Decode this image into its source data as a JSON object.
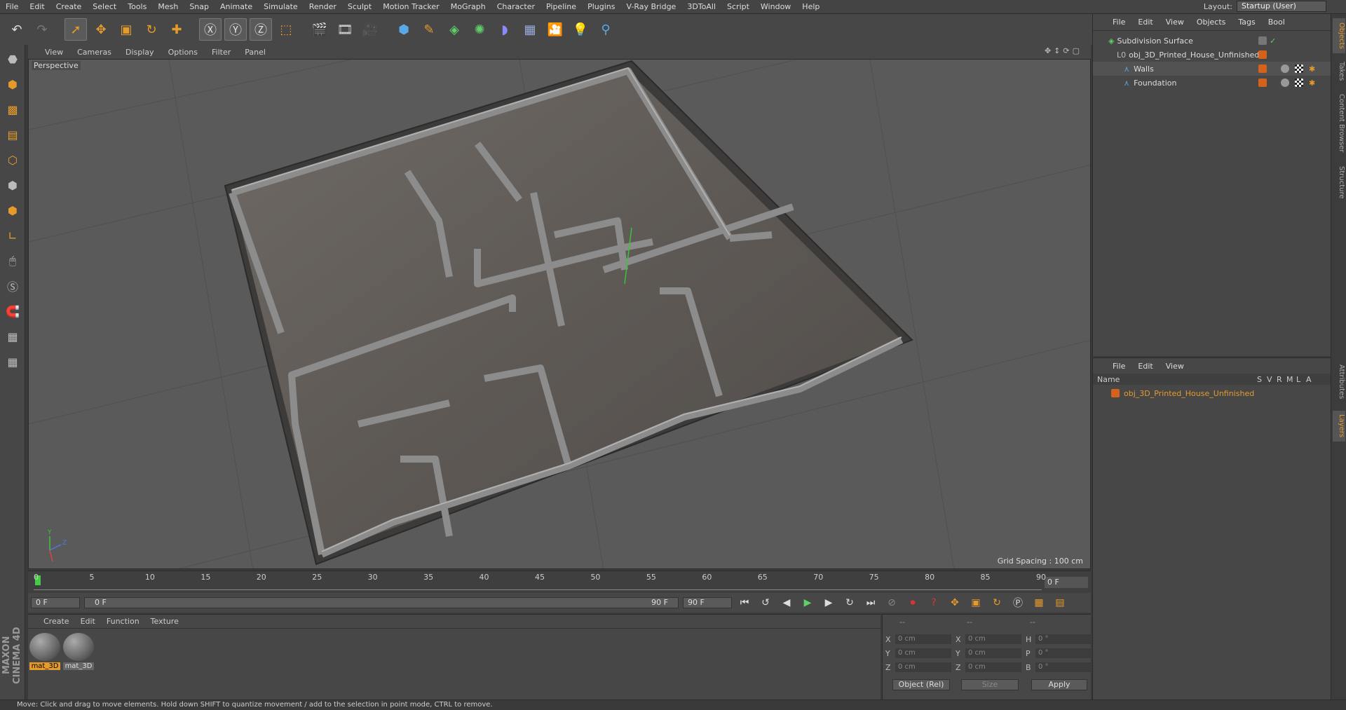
{
  "menu": [
    "File",
    "Edit",
    "Create",
    "Select",
    "Tools",
    "Mesh",
    "Snap",
    "Animate",
    "Simulate",
    "Render",
    "Sculpt",
    "Motion Tracker",
    "MoGraph",
    "Character",
    "Pipeline",
    "Plugins",
    "V-Ray Bridge",
    "3DToAll",
    "Script",
    "Window",
    "Help"
  ],
  "layout": {
    "label": "Layout:",
    "value": "Startup (User)"
  },
  "viewport": {
    "menu": [
      "View",
      "Cameras",
      "Display",
      "Options",
      "Filter",
      "Panel"
    ],
    "label": "Perspective",
    "grid_spacing": "Grid Spacing : 100 cm"
  },
  "timeline": {
    "ticks": [
      "0",
      "5",
      "10",
      "15",
      "20",
      "25",
      "30",
      "35",
      "40",
      "45",
      "50",
      "55",
      "60",
      "65",
      "70",
      "75",
      "80",
      "85",
      "90"
    ],
    "current_frame": "0 F"
  },
  "playback": {
    "start": "0 F",
    "range_start": "0 F",
    "range_end": "90 F",
    "end": "90 F"
  },
  "materials": {
    "menu": [
      "Create",
      "Edit",
      "Function",
      "Texture"
    ],
    "items": [
      "mat_3D",
      "mat_3D"
    ]
  },
  "coords": {
    "headers": [
      "--",
      "--",
      "--"
    ],
    "rows": [
      {
        "l1": "X",
        "v1": "0 cm",
        "l2": "X",
        "v2": "0 cm",
        "l3": "H",
        "v3": "0 °"
      },
      {
        "l1": "Y",
        "v1": "0 cm",
        "l2": "Y",
        "v2": "0 cm",
        "l3": "P",
        "v3": "0 °"
      },
      {
        "l1": "Z",
        "v1": "0 cm",
        "l2": "Z",
        "v2": "0 cm",
        "l3": "B",
        "v3": "0 °"
      }
    ],
    "mode": "Object (Rel)",
    "size": "Size",
    "apply": "Apply"
  },
  "objects": {
    "menu": [
      "File",
      "Edit",
      "View",
      "Objects",
      "Tags",
      "Bool"
    ],
    "items": [
      {
        "name": "Subdivision Surface",
        "level": 0
      },
      {
        "name": "obj_3D_Printed_House_Unfinished",
        "level": 1
      },
      {
        "name": "Walls",
        "level": 2
      },
      {
        "name": "Foundation",
        "level": 2
      }
    ]
  },
  "layers": {
    "menu": [
      "File",
      "Edit",
      "View"
    ],
    "headers": [
      "Name",
      "S",
      "V",
      "R",
      "M",
      "L",
      "A"
    ],
    "items": [
      "obj_3D_Printed_House_Unfinished"
    ]
  },
  "side_tabs": [
    "Objects",
    "Takes",
    "Content Browser",
    "Structure",
    "Attributes",
    "Layers"
  ],
  "status": "Move: Click and drag to move elements. Hold down SHIFT to quantize movement / add to the selection in point mode, CTRL to remove.",
  "brand": "MAXON CINEMA 4D",
  "colors": {
    "accent": "#e59b2c",
    "panel": "#474747",
    "viewport": "#5a5a5a"
  }
}
